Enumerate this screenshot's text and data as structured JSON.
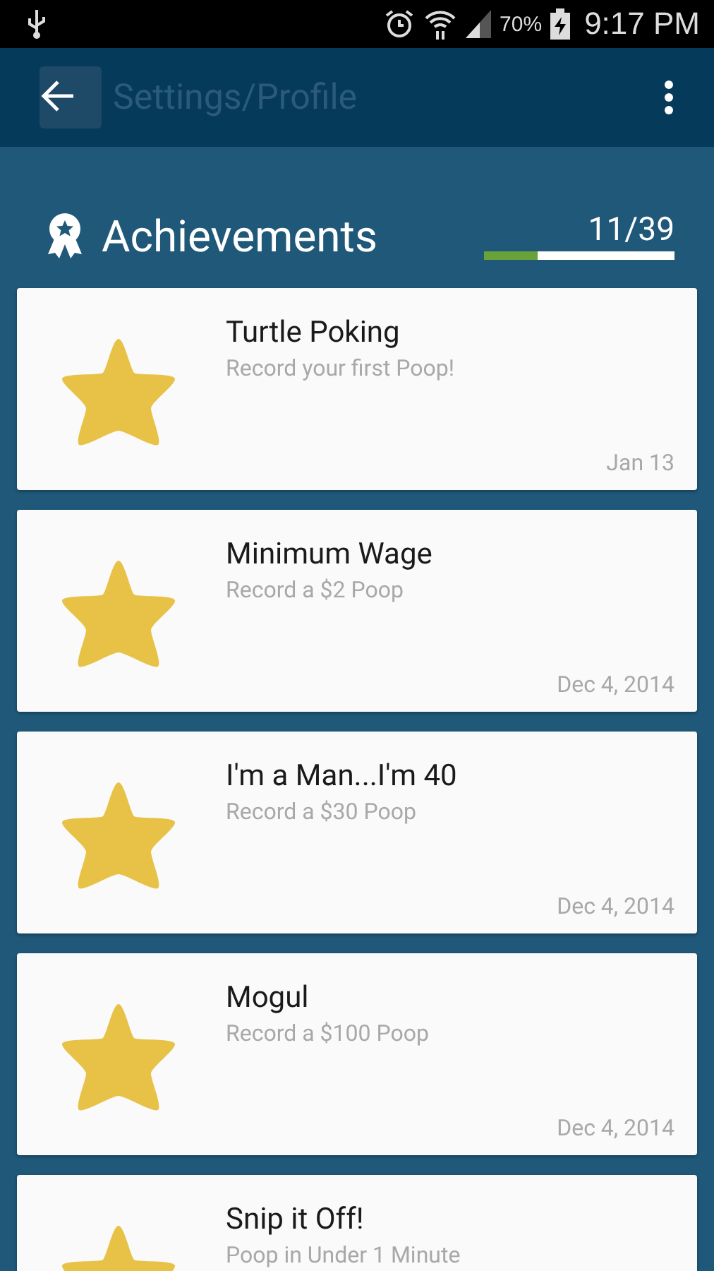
{
  "status_bar": {
    "battery": "70%",
    "time": "9:17 PM"
  },
  "app_bar": {
    "title": "Settings/Profile"
  },
  "achievements": {
    "title": "Achievements",
    "count": "11/39",
    "level": 0.28
  },
  "items": [
    {
      "title": "Turtle Poking",
      "description": "Record your first Poop!",
      "date": "Jan 13"
    },
    {
      "title": "Minimum Wage",
      "description": "Record a $2 Poop",
      "date": "Dec 4, 2014"
    },
    {
      "title": "I'm a Man...I'm 40",
      "description": "Record a $30 Poop",
      "date": "Dec 4, 2014"
    },
    {
      "title": "Mogul",
      "description": "Record a $100 Poop",
      "date": "Dec 4, 2014"
    },
    {
      "title": "Snip it Off!",
      "description": "Poop in Under 1 Minute"
    }
  ]
}
